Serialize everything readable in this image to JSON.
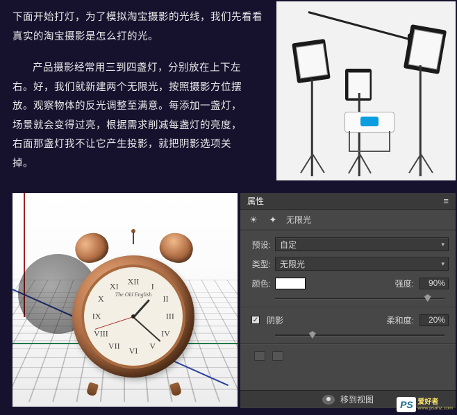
{
  "paragraphs": {
    "p1": "下面开始打灯，为了模拟淘宝摄影的光线，我们先看看真实的淘宝摄影是怎么打的光。",
    "p2": "产品摄影经常用三到四盏灯，分别放在上下左右。好，我们就新建两个无限光，按照摄影方位摆放。观察物体的反光调整至满意。每添加一盏灯，场景就会变得过亮，根据需求削减每盏灯的亮度，右面那盏灯我不让它产生投影，就把阴影选项关掉。"
  },
  "clock": {
    "script_label": "The Old English",
    "numerals": {
      "n1": "I",
      "n2": "II",
      "n3": "III",
      "n4": "IV",
      "n5": "V",
      "n6": "VI",
      "n7": "VII",
      "n8": "VIII",
      "n9": "IX",
      "n10": "X",
      "n11": "XI",
      "n12": "XII"
    }
  },
  "panel": {
    "tab": "属性",
    "light_type_title": "无限光",
    "rows": {
      "preset_label": "预设:",
      "preset_value": "自定",
      "type_label": "类型:",
      "type_value": "无限光",
      "color_label": "颜色:",
      "color_value": "#ffffff",
      "intensity_label": "强度:",
      "intensity_value": "90%",
      "shadow_label": "阴影",
      "shadow_checked": true,
      "softness_label": "柔和度:",
      "softness_value": "20%"
    },
    "slider_positions": {
      "intensity": 88,
      "softness": 20
    },
    "footer_button": "移到视图"
  },
  "watermark": {
    "ps": "PS",
    "cn": "爱好者",
    "en": "www.psahz.com"
  },
  "icons": {
    "menu": "menu-icon",
    "sun": "sun-icon",
    "light": "lightbulb-icon",
    "dropdown": "chevron-down-icon",
    "eye": "eye-icon",
    "globe": "globe-icon",
    "swap": "swap-icon"
  }
}
